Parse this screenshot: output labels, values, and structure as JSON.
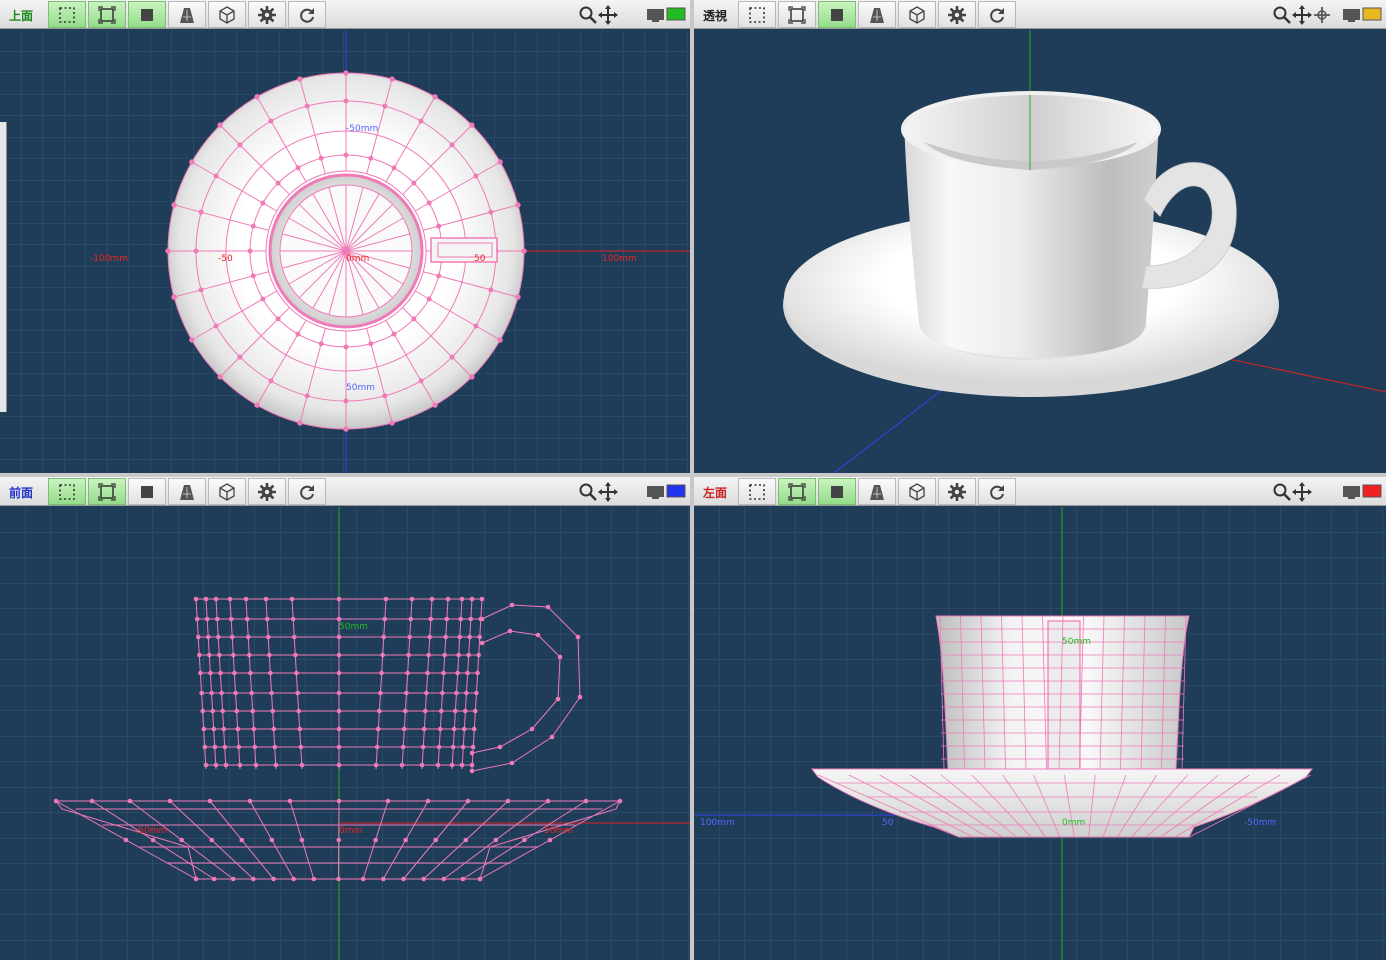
{
  "viewports": {
    "top": {
      "label": "上面",
      "label_color": "#1a8a1a",
      "axis_labels": [
        "-50mm",
        "-100mm",
        "-50",
        "0mm",
        "50",
        "100mm",
        "50mm"
      ]
    },
    "perspective": {
      "label": "透視",
      "label_color": "#222222"
    },
    "front": {
      "label": "前面",
      "label_color": "#2233cc",
      "axis_labels": [
        "50mm",
        "-50mm",
        "0mm",
        "50mm"
      ]
    },
    "left": {
      "label": "左面",
      "label_color": "#cc2222",
      "axis_labels": [
        "50mm",
        "100mm",
        "50",
        "0mm",
        "-50mm"
      ]
    }
  },
  "toolbar": {
    "buttons": [
      "select-region",
      "select-fit",
      "display-solid",
      "display-perspective",
      "display-cube",
      "settings",
      "refresh"
    ],
    "icons": [
      "zoom-icon",
      "move-icon",
      "rotate-icon",
      "monitor-icon"
    ]
  },
  "colors": {
    "viewport_bg": "#1f3d58",
    "grid": "#3c5c78",
    "wire": "#f07ab8",
    "axis_x": "#dd2222",
    "axis_y": "#22aa22",
    "axis_z": "#3344ee",
    "toggle_on": "#94dc8a"
  }
}
